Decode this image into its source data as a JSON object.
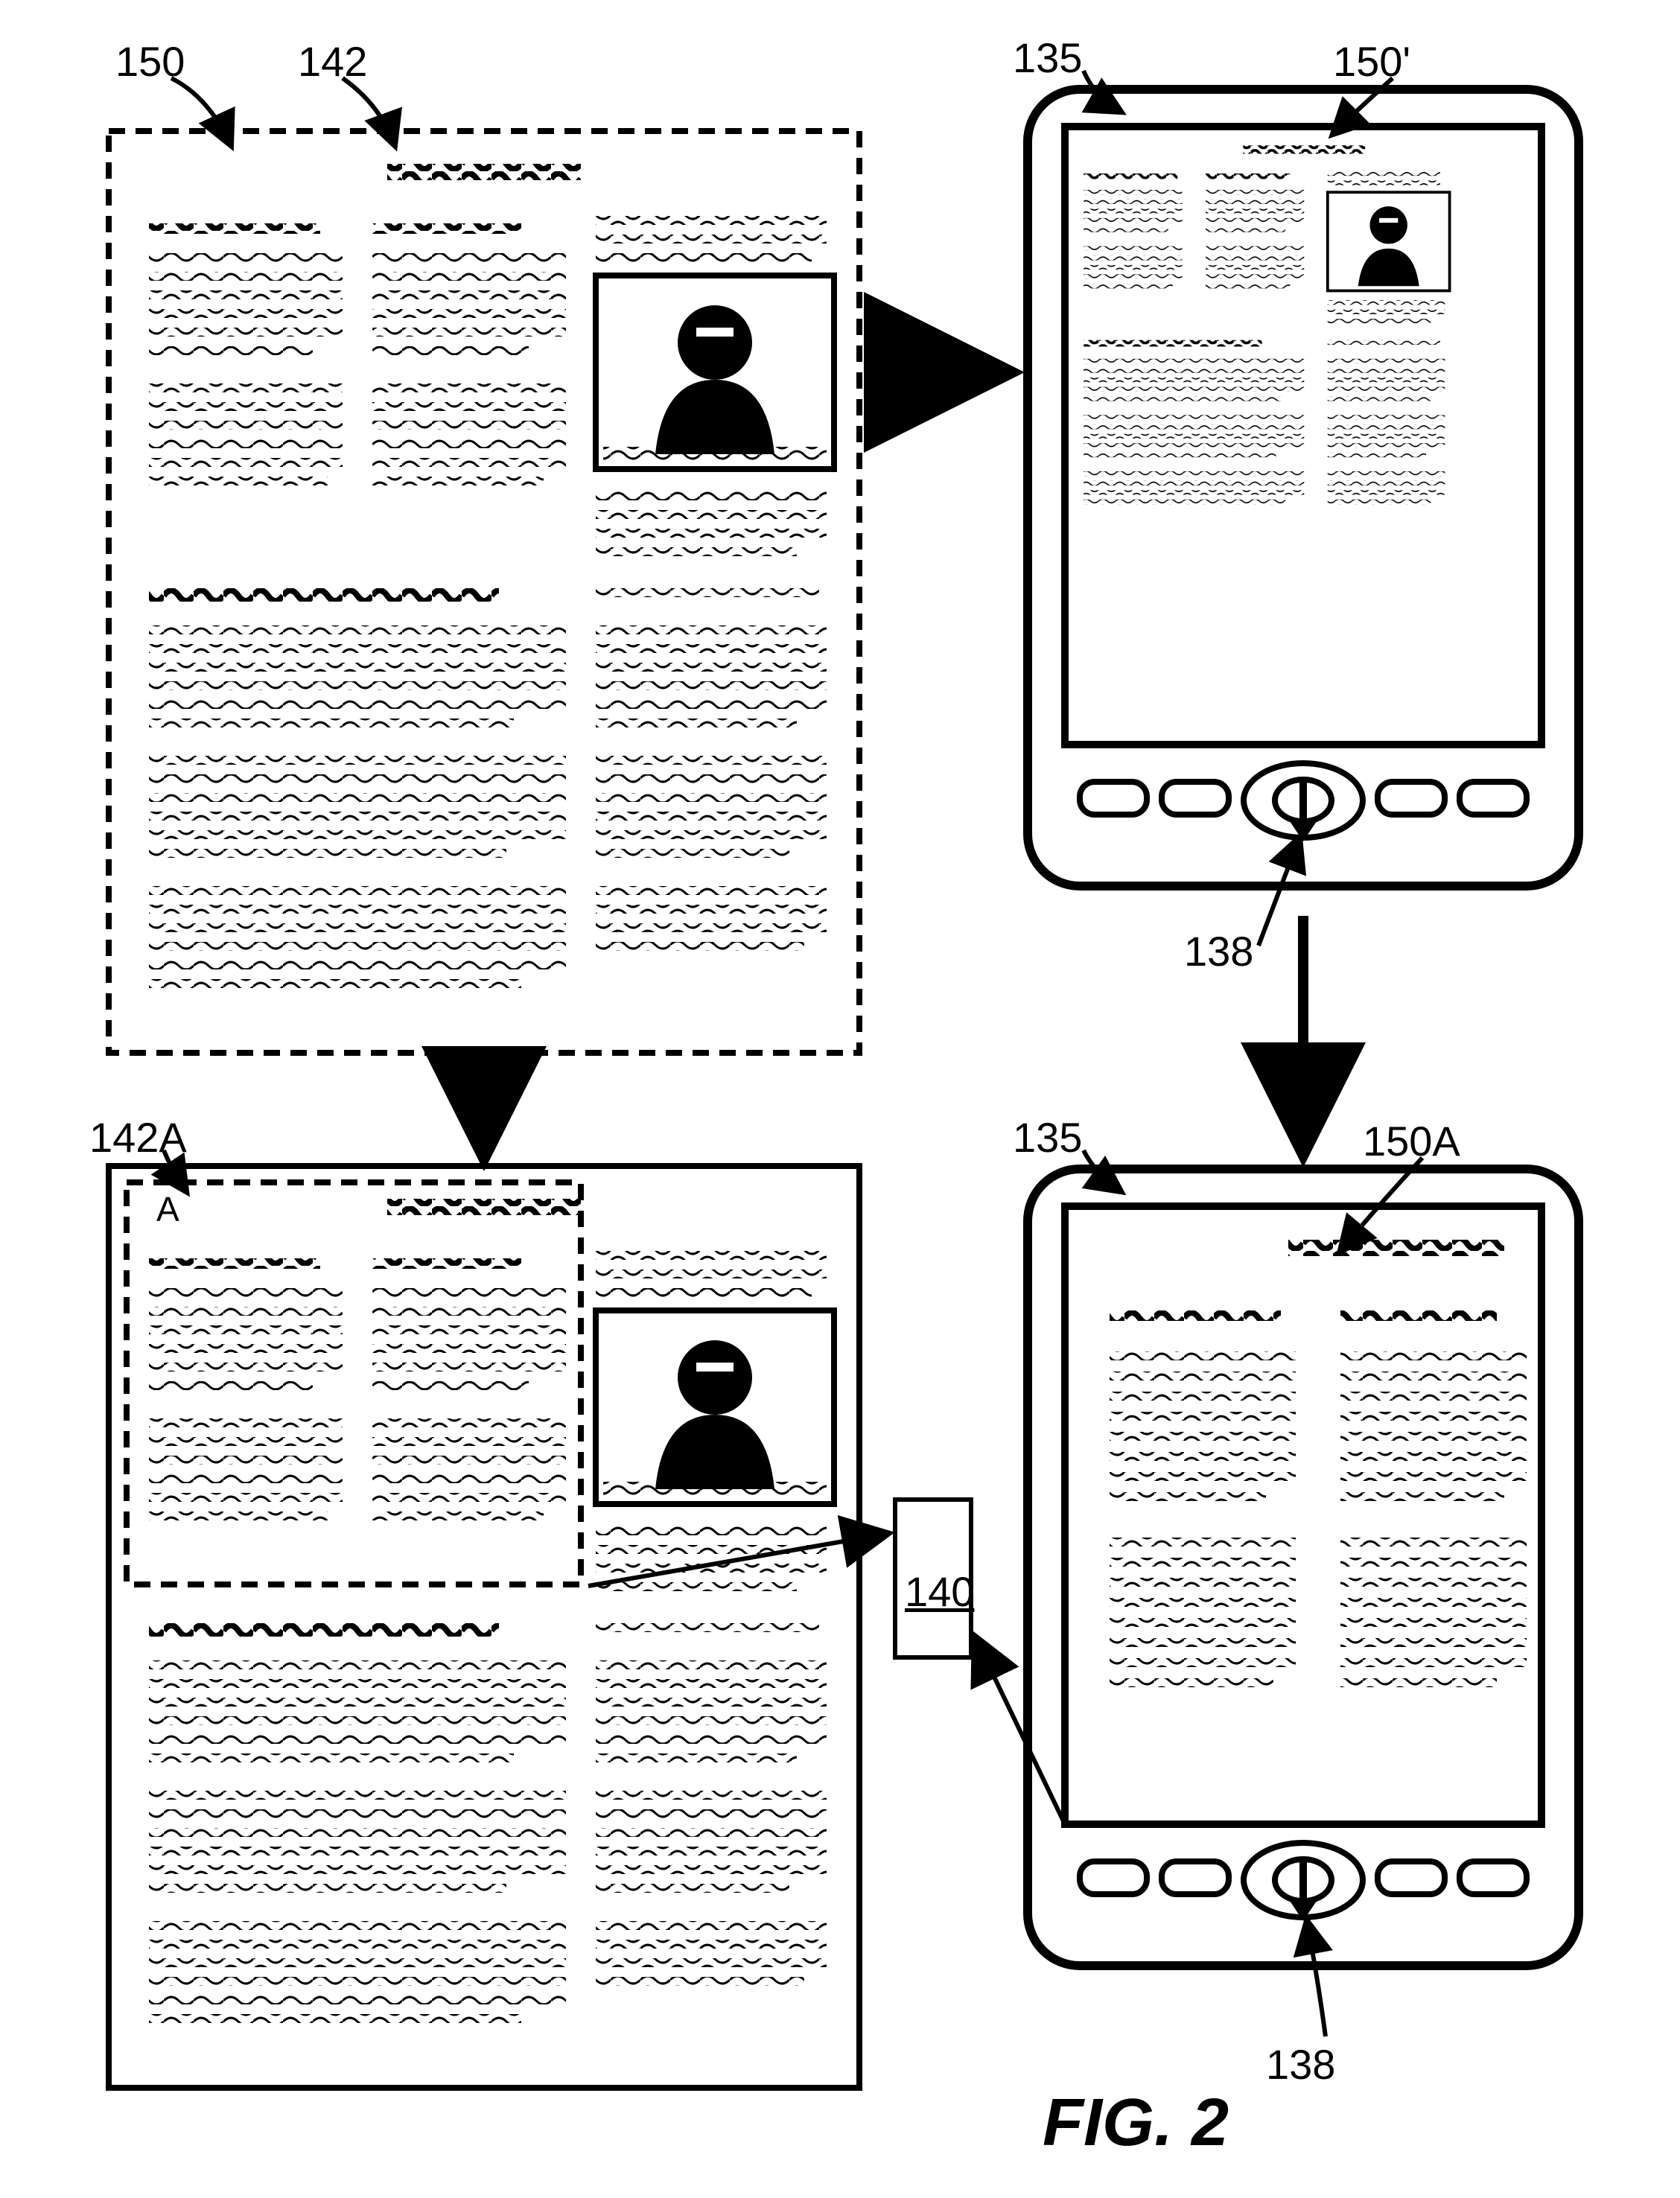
{
  "figure_label": "FIG. 2",
  "labels": {
    "l150": "150",
    "l142": "142",
    "l135_top": "135",
    "l150p": "150'",
    "l138_top": "138",
    "l142A": "142A",
    "l135_bot": "135",
    "l150A": "150A",
    "l140": "140",
    "l138_bot": "138",
    "regionA": "A"
  }
}
